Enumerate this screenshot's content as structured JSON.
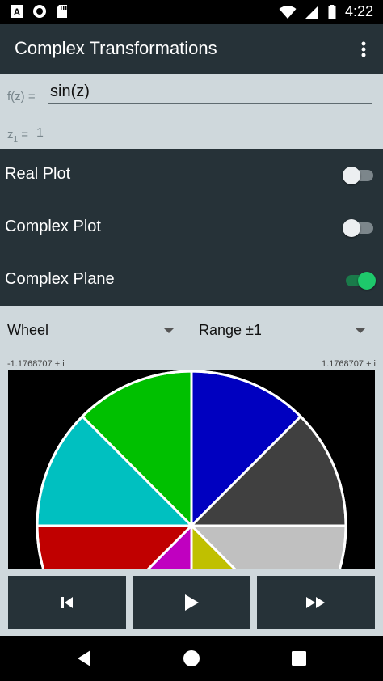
{
  "status_bar": {
    "time": "4:22",
    "icons": [
      "a-box-icon",
      "circle-o-icon",
      "sd-card-icon",
      "wifi-icon",
      "signal-icon",
      "battery-icon"
    ]
  },
  "app_bar": {
    "title": "Complex Transformations",
    "menu_icon": "more-vert-icon"
  },
  "function": {
    "label": "f(z) =",
    "value": "sin(z)",
    "z1_label": "z",
    "z1_sub": "1",
    "z1_eq": " =",
    "z1_value": "1"
  },
  "toggles": [
    {
      "label": "Real Plot",
      "on": false
    },
    {
      "label": "Complex Plot",
      "on": false
    },
    {
      "label": "Complex Plane",
      "on": true
    }
  ],
  "plot": {
    "mode_select": "Wheel",
    "range_select": "Range ±1",
    "range_left": "-1.1768707 + i",
    "range_right": "1.1768707 + i",
    "wheel_colors": [
      "#00c000",
      "#0000c0",
      "#404040",
      "#c0c0c0",
      "#c0c000",
      "#c000c0",
      "#c00000",
      "#00c0c0"
    ]
  },
  "controls": {
    "prev_icon": "skip-previous-icon",
    "play_icon": "play-icon",
    "ffwd_icon": "fast-forward-icon"
  },
  "nav": {
    "back_icon": "back-triangle-icon",
    "home_icon": "home-circle-icon",
    "recents_icon": "recents-square-icon"
  }
}
